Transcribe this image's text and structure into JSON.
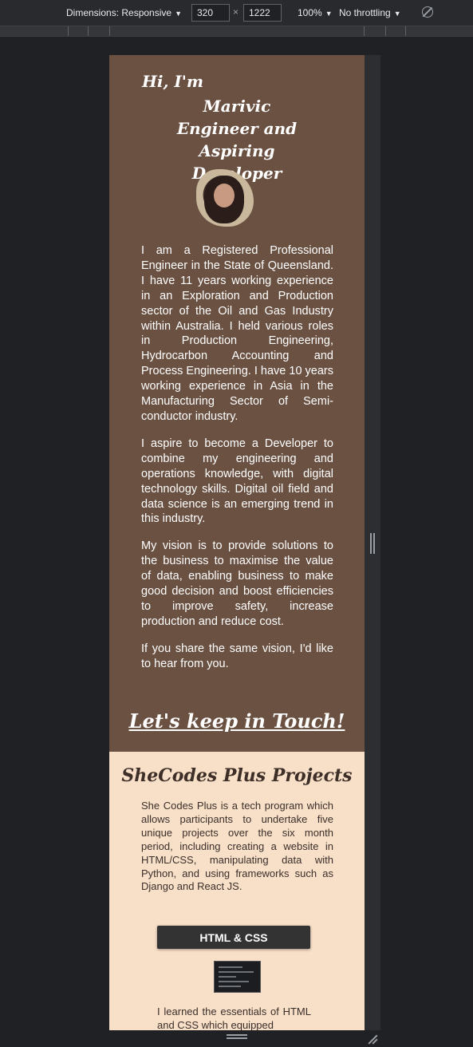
{
  "devtools": {
    "dimensions_label": "Dimensions: Responsive",
    "width_value": "320",
    "times_symbol": "×",
    "height_value": "1222",
    "zoom_label": "100%",
    "throttle_label": "No throttling",
    "dropdown_glyph": "▼"
  },
  "hero": {
    "greeting": "Hi, I'm",
    "name_line1": "Marivic",
    "name_line2": "Engineer and Aspiring",
    "name_line3": "Developer",
    "bio": [
      "I am a Registered Professional Engineer in the State of Queensland. I have 11 years working experience in an Exploration and Production sector of the Oil and Gas Industry within Australia. I held various roles in Production Engineering, Hydrocarbon Accounting and Process Engineering. I have 10 years working experience in Asia in the Manufacturing Sector of Semi-conductor industry.",
      "I aspire to become a Developer to combine my engineering and operations knowledge, with digital technology skills. Digital oil field and data science is an emerging trend in this industry.",
      "My vision is to provide solutions to the business to maximise the value of data, enabling business to make good decision and boost efficiencies to improve safety, increase production and reduce cost.",
      "If you share the same vision, I'd like to hear from you."
    ],
    "contact_link": "Let's keep in Touch!"
  },
  "projects": {
    "title": "SheCodes Plus Projects",
    "description": "She Codes Plus is a tech program which allows participants to undertake five unique projects over the six month period, including creating a website in HTML/CSS, manipulating data with Python, and using frameworks such as Django and React JS.",
    "html_button": "HTML & CSS",
    "html_description": "I learned the essentials of HTML and CSS which equipped"
  }
}
